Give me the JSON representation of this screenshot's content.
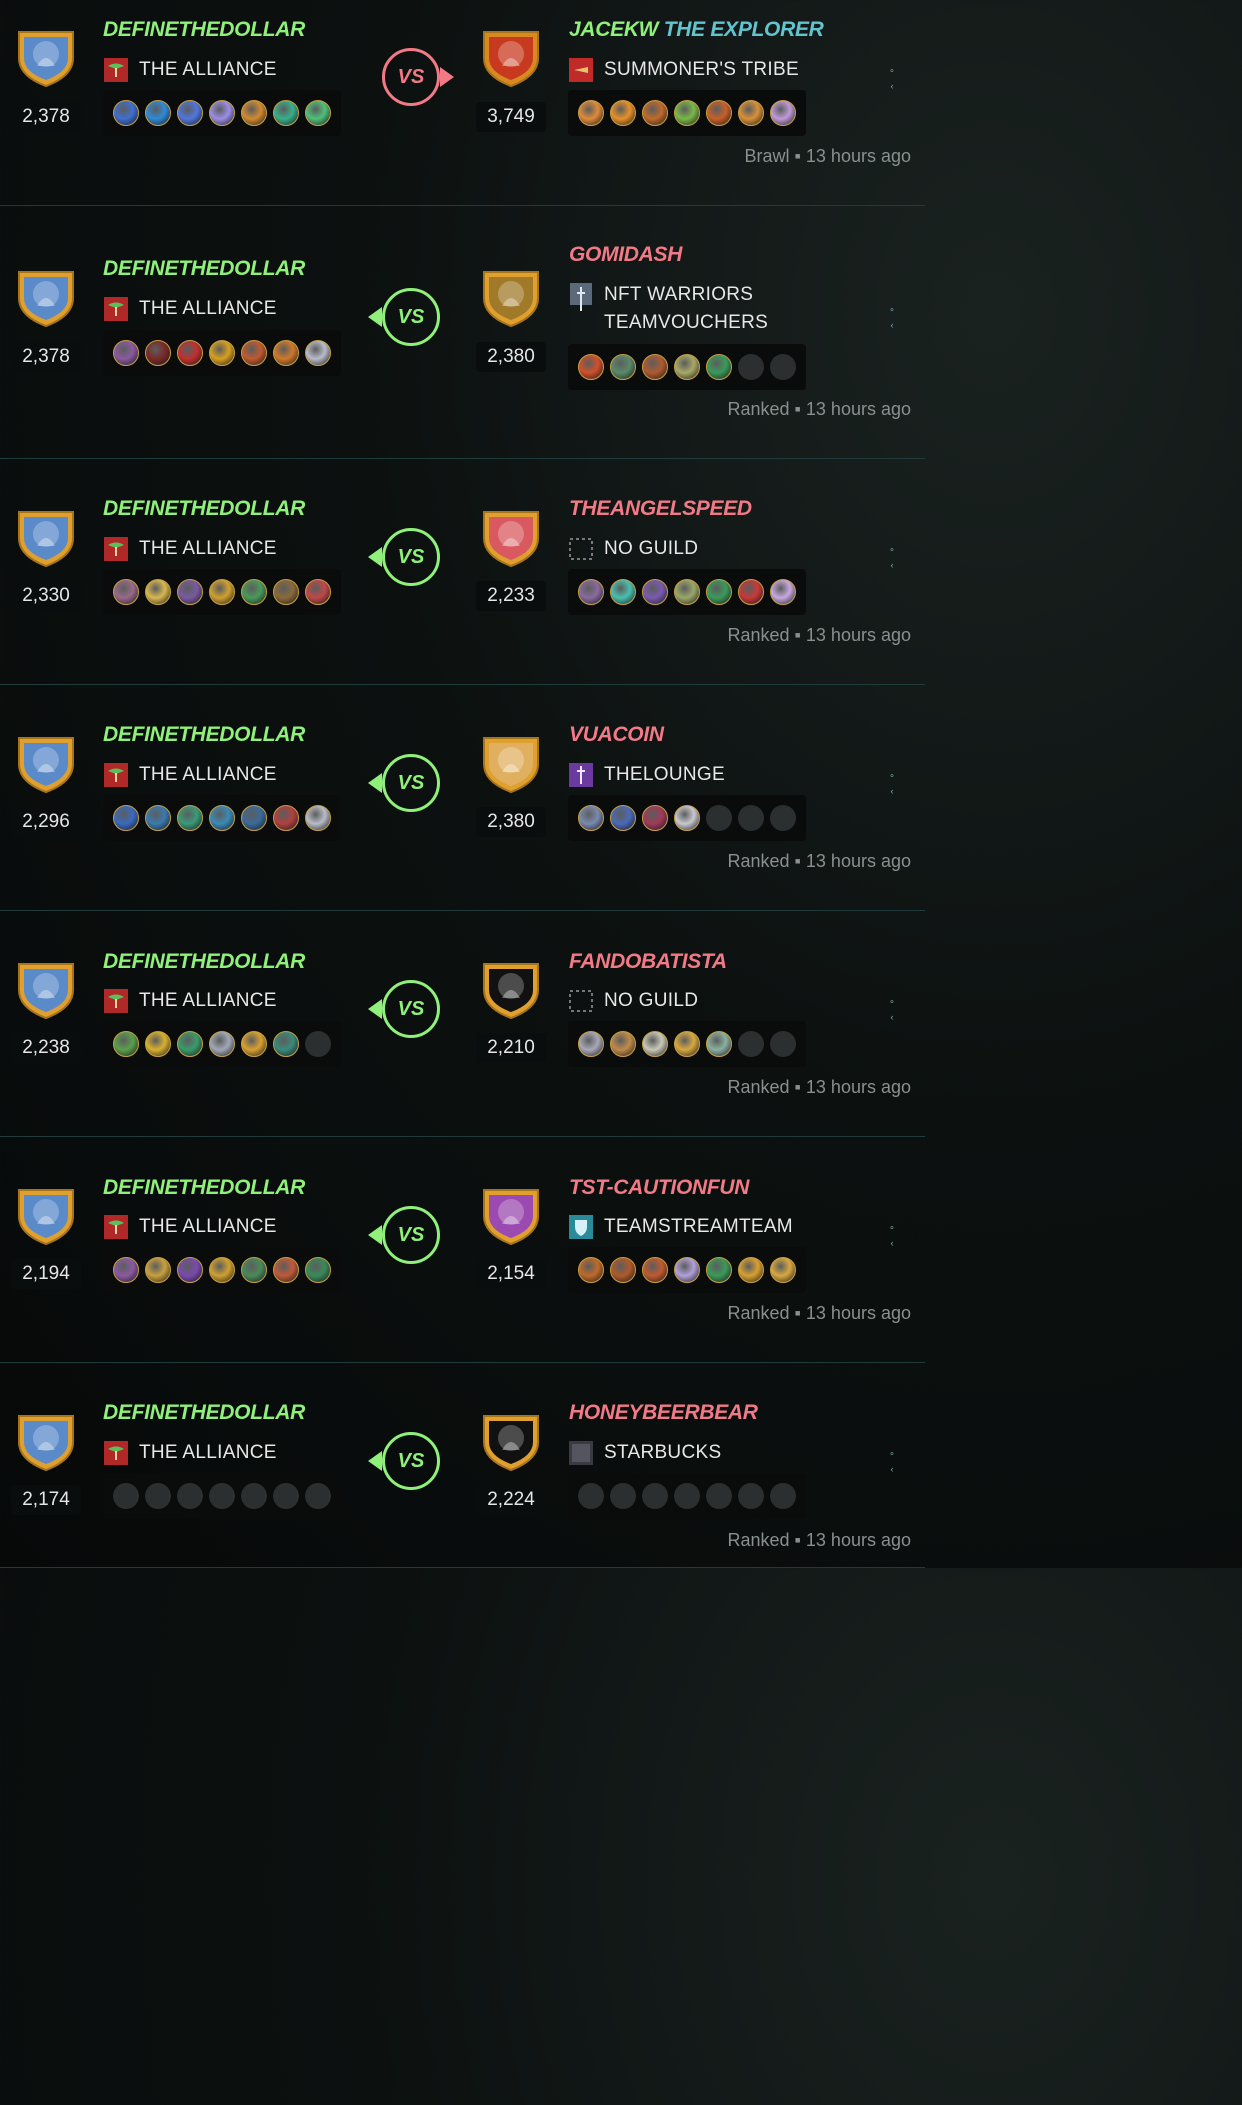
{
  "battles": [
    {
      "left": {
        "name": "DEFINETHEDOLLAR",
        "guild": "THE ALLIANCE",
        "rating": "2,378",
        "team": [
          "#3f6fd0",
          "#2f8ad8",
          "#5076e0",
          "#9a8ee8",
          "#d08a30",
          "#38b08a",
          "#4ec07a"
        ]
      },
      "right": {
        "name": "JACEKW",
        "title": "THE EXPLORER",
        "guild": "SUMMONER'S TRIBE",
        "rating": "3,749",
        "team": [
          "#e08a3a",
          "#e8902a",
          "#c06a2a",
          "#7ab848",
          "#c8602a",
          "#d89038",
          "#c09ad8"
        ]
      },
      "result": "loss",
      "vs": "VS",
      "meta": "Brawl ▪ 13 hours ago"
    },
    {
      "left": {
        "name": "DEFINETHEDOLLAR",
        "guild": "THE ALLIANCE",
        "rating": "2,378",
        "team": [
          "#8a5aa0",
          "#7a2a2a",
          "#c03030",
          "#d8a020",
          "#c05a30",
          "#d0782a",
          "#b8bcc8"
        ]
      },
      "right": {
        "name": "GOMIDASH",
        "guild": "NFT WARRIORS TEAMVOUCHERS",
        "guild_line1": "NFT WARRIORS",
        "guild_line2": "TEAMVOUCHERS",
        "rating": "2,380",
        "team": [
          "#d0502a",
          "#5a8a6a",
          "#b05a30",
          "#a8a868",
          "#3a9a5a",
          null,
          null
        ]
      },
      "result": "win",
      "vs": "VS",
      "meta": "Ranked ▪ 13 hours ago"
    },
    {
      "left": {
        "name": "DEFINETHEDOLLAR",
        "guild": "THE ALLIANCE",
        "rating": "2,330",
        "team": [
          "#9a6a8a",
          "#d8b850",
          "#7a5aa0",
          "#d0a030",
          "#4a9a5a",
          "#8a6a3a",
          "#c04848"
        ]
      },
      "right": {
        "name": "THEANGELSPEED",
        "guild": "NO GUILD",
        "rating": "2,233",
        "team": [
          "#8a6aa0",
          "#48c0b0",
          "#7a5ab0",
          "#9aa868",
          "#3a9a5a",
          "#c83838",
          "#c8a8e0"
        ]
      },
      "result": "win",
      "vs": "VS",
      "meta": "Ranked ▪ 13 hours ago"
    },
    {
      "left": {
        "name": "DEFINETHEDOLLAR",
        "guild": "THE ALLIANCE",
        "rating": "2,296",
        "team": [
          "#3a6ac0",
          "#3a7ab0",
          "#3a9a7a",
          "#3a8ab8",
          "#3a6a9a",
          "#b04040",
          "#b8bcc8"
        ]
      },
      "right": {
        "name": "VUACOIN",
        "guild": "THELOUNGE",
        "rating": "2,380",
        "team": [
          "#7a8ab0",
          "#4a6ab8",
          "#a03a5a",
          "#c8c8d0",
          null,
          null,
          null
        ]
      },
      "result": "win",
      "vs": "VS",
      "meta": "Ranked ▪ 13 hours ago"
    },
    {
      "left": {
        "name": "DEFINETHEDOLLAR",
        "guild": "THE ALLIANCE",
        "rating": "2,238",
        "team": [
          "#5aa04a",
          "#d8b030",
          "#3a9a6a",
          "#a0a8b8",
          "#d8a030",
          "#3a8a7a",
          null
        ]
      },
      "right": {
        "name": "FANDOBATISTA",
        "guild": "NO GUILD",
        "rating": "2,210",
        "team": [
          "#a8a8b8",
          "#c08a4a",
          "#c8c8b8",
          "#d8a840",
          "#8ab0a0",
          null,
          null
        ]
      },
      "result": "win",
      "vs": "VS",
      "meta": "Ranked ▪ 13 hours ago"
    },
    {
      "left": {
        "name": "DEFINETHEDOLLAR",
        "guild": "THE ALLIANCE",
        "rating": "2,194",
        "team": [
          "#8a5aa0",
          "#c8a040",
          "#7a4ab0",
          "#d0a030",
          "#4a8a5a",
          "#c05a3a",
          "#3a8a5a"
        ]
      },
      "right": {
        "name": "TST-CAUTIONFUN",
        "guild": "TEAMSTREAMTEAM",
        "rating": "2,154",
        "team": [
          "#c06a2a",
          "#b05a2a",
          "#c05a30",
          "#b0a0d8",
          "#3a9a5a",
          "#d8a030",
          "#d8a840"
        ]
      },
      "result": "win",
      "vs": "VS",
      "meta": "Ranked ▪ 13 hours ago"
    },
    {
      "left": {
        "name": "DEFINETHEDOLLAR",
        "guild": "THE ALLIANCE",
        "rating": "2,174",
        "team": [
          null,
          null,
          null,
          null,
          null,
          null,
          null
        ]
      },
      "right": {
        "name": "HONEYBEERBEAR",
        "guild": "STARBUCKS",
        "rating": "2,224",
        "team": [
          null,
          null,
          null,
          null,
          null,
          null,
          null
        ]
      },
      "result": "win",
      "vs": "VS",
      "meta": "Ranked ▪ 13 hours ago"
    }
  ],
  "colors": {
    "win": "#8ff07a",
    "loss": "#f27a86",
    "title": "#62c4cf",
    "divider": "#1f3b3b"
  },
  "icons": {
    "left_avatar": "wizard-avatar-icon",
    "guild_alliance": "alliance-banner-icon",
    "guild_none": "no-guild-icon",
    "more": "more-dots-icon"
  }
}
